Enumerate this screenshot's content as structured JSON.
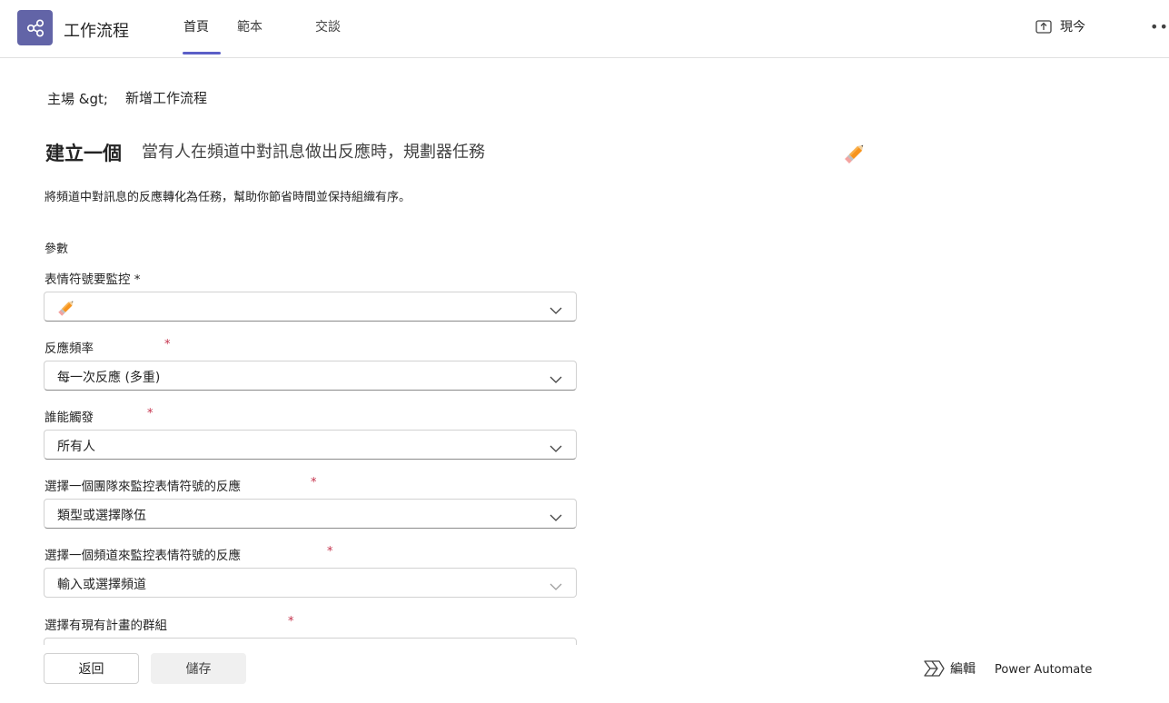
{
  "app": {
    "title": "工作流程",
    "icon": "workflows-icon"
  },
  "tabs": [
    {
      "label": "首頁",
      "active": true
    },
    {
      "label": "範本",
      "active": false
    },
    {
      "label": "交談",
      "active": false
    }
  ],
  "header": {
    "popout_label": "現今",
    "more_icon": "more-icon"
  },
  "breadcrumb": {
    "home": "主場 &gt;",
    "current": "新增工作流程"
  },
  "page": {
    "title": "建立一個",
    "flow_name": "當有人在頻道中對訊息做出反應時，規劃器任務",
    "description": "將頻道中對訊息的反應轉化為任務，幫助你節省時間並保持組織有序。",
    "section_label": "參數"
  },
  "fields": [
    {
      "label": "表情符號要監控 *",
      "value": "",
      "emoji": "pencil-emoji"
    },
    {
      "label": "反應頻率",
      "required": "*",
      "value": "每一次反應 (多重)"
    },
    {
      "label": "誰能觸發",
      "required": "*",
      "value": "所有人"
    },
    {
      "label": "選擇一個團隊來監控表情符號的反應",
      "required": "*",
      "value": "類型或選擇隊伍"
    },
    {
      "label": "選擇一個頻道來監控表情符號的反應",
      "required": "*",
      "value": "輸入或選擇頻道"
    },
    {
      "label": "選擇有現有計畫的群組",
      "required": "*",
      "value": ""
    }
  ],
  "footer": {
    "back_label": "返回",
    "save_label": "儲存",
    "edit_label": "編輯",
    "power_automate_label": "Power Automate"
  },
  "colors": {
    "accent": "#5b5fc7",
    "app_icon_bg": "#6264a7",
    "required": "#c4314b"
  }
}
